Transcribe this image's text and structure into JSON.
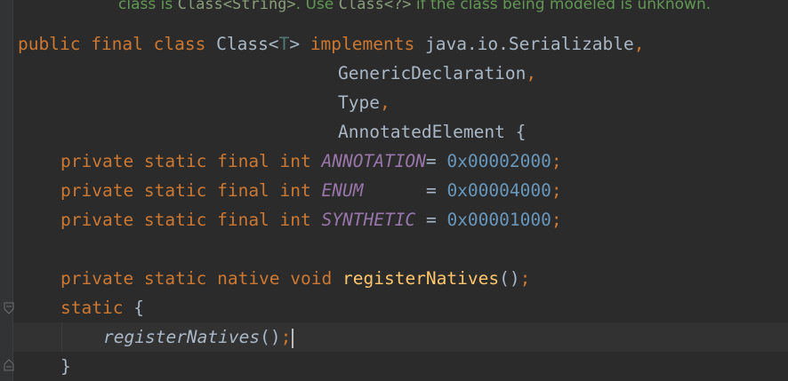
{
  "doc_comment": {
    "prefix": "class is ",
    "code1": "Class<String>",
    "middle": ". Use ",
    "code2": "Class<?>",
    "suffix": " if the class being modeled is unknown."
  },
  "code": {
    "line1": {
      "kw_public": "public",
      "kw_final": "final",
      "kw_class": "class",
      "class_name": "Class<",
      "type_param": "T",
      "close": ">",
      "kw_implements": "implements",
      "iface1": "java.io.Serializable",
      "comma": ","
    },
    "line2": {
      "iface": "GenericDeclaration",
      "comma": ","
    },
    "line3": {
      "iface": "Type",
      "comma": ","
    },
    "line4": {
      "iface": "AnnotatedElement",
      "brace": "{"
    },
    "field1": {
      "modifiers": "private static final int",
      "name": "ANNOTATION",
      "eq": "=",
      "value": "0x00002000",
      "semi": ";"
    },
    "field2": {
      "modifiers": "private static final int",
      "name": "ENUM",
      "pad": "      ",
      "eq": "=",
      "value": "0x00004000",
      "semi": ";"
    },
    "field3": {
      "modifiers": "private static final int",
      "name": "SYNTHETIC",
      "pad": " ",
      "eq": "=",
      "value": "0x00001000",
      "semi": ";"
    },
    "native_decl": {
      "modifiers": "private static native void",
      "method": "registerNatives",
      "parens": "()",
      "semi": ";"
    },
    "static_block": {
      "kw": "static",
      "brace": "{"
    },
    "call": {
      "method": "registerNatives",
      "parens": "()",
      "semi": ";"
    },
    "close_brace": "}"
  },
  "colors": {
    "background": "#2b2b2b",
    "keyword": "#cc7832",
    "text": "#a9b7c6",
    "field": "#9876aa",
    "number": "#6897bb",
    "method": "#ffc66d",
    "comment": "#629755"
  }
}
